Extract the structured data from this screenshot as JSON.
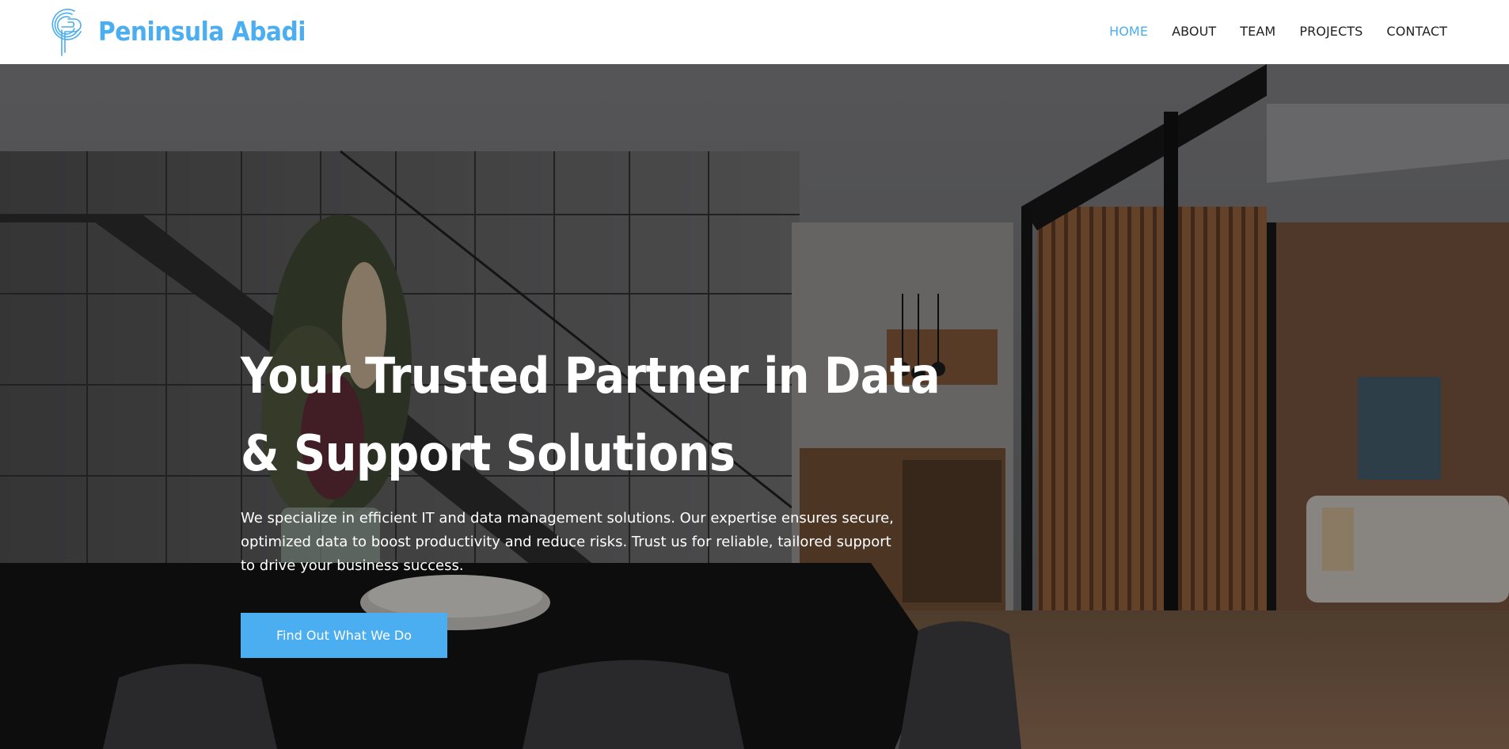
{
  "header": {
    "brand_name": "Peninsula Abadi",
    "logo_icon": "peninsula-abadi-logo-icon",
    "nav": [
      {
        "label": "HOME",
        "active": true
      },
      {
        "label": "ABOUT",
        "active": false
      },
      {
        "label": "TEAM",
        "active": false
      },
      {
        "label": "PROJECTS",
        "active": false
      },
      {
        "label": "CONTACT",
        "active": false
      }
    ]
  },
  "hero": {
    "title": "Your Trusted Partner in Data & Support Solutions",
    "description": "We specialize in efficient IT and data management solutions. Our expertise ensures secure, optimized data to boost productivity and reduce risks. Trust us for reliable, tailored support to drive your business success.",
    "cta_label": "Find Out What We Do",
    "background_image": "modern-interior-staircase-photo"
  },
  "colors": {
    "accent": "#4aaef0",
    "nav_text": "#222222",
    "header_bg": "#ffffff",
    "hero_text": "#ffffff"
  }
}
